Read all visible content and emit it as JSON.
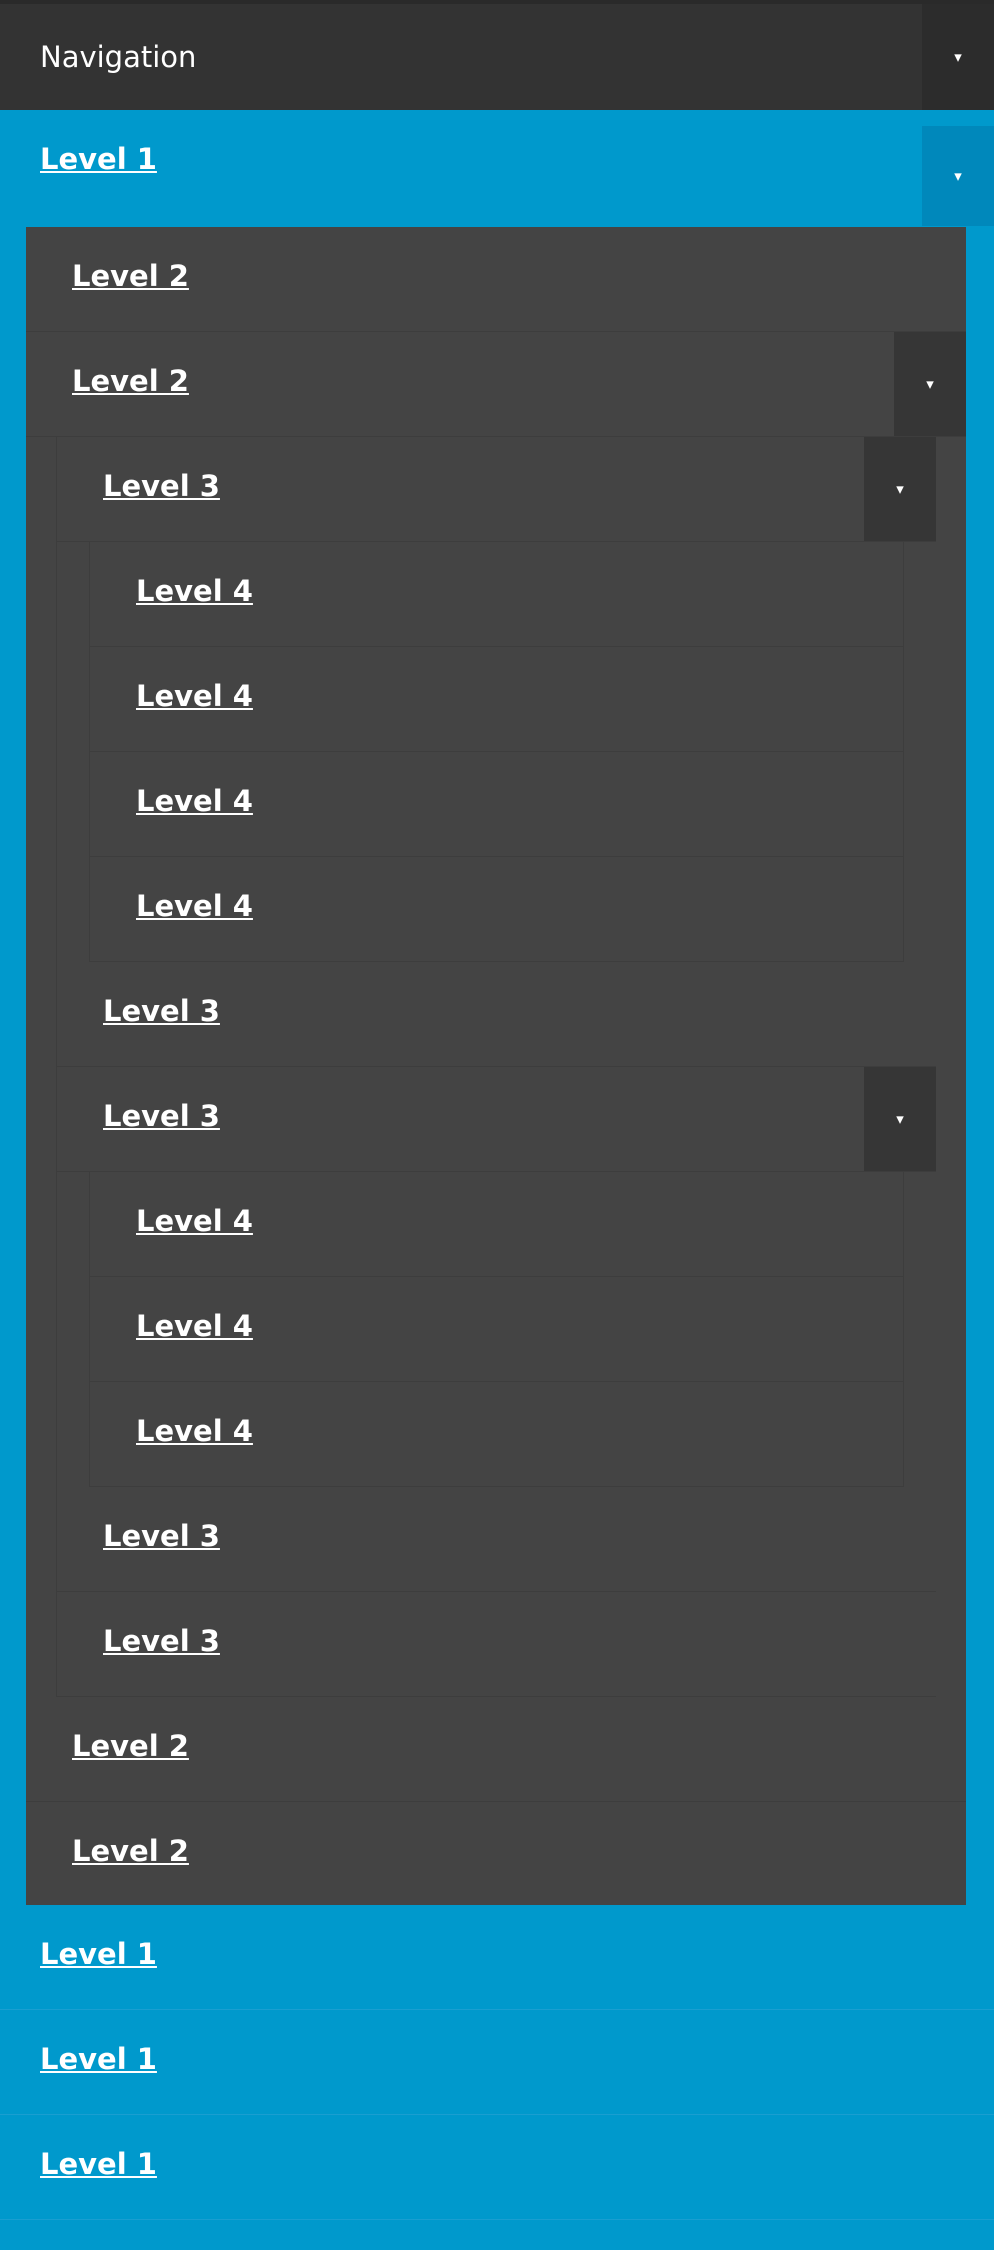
{
  "nav": {
    "title": "Navigation",
    "toggle_icon": "▾",
    "colors": {
      "topbar": "#333333",
      "level1": "#0099cc",
      "panel": "#444444"
    }
  },
  "level1": [
    "Level 1",
    "Level 1",
    "Level 1",
    "Level 1"
  ],
  "level2": [
    "Level 2",
    "Level 2",
    "Level 2",
    "Level 2"
  ],
  "level3": [
    "Level 3",
    "Level 3",
    "Level 3",
    "Level 3",
    "Level 3"
  ],
  "level4_a": [
    "Level 4",
    "Level 4",
    "Level 4",
    "Level 4"
  ],
  "level4_b": [
    "Level 4",
    "Level 4",
    "Level 4"
  ]
}
